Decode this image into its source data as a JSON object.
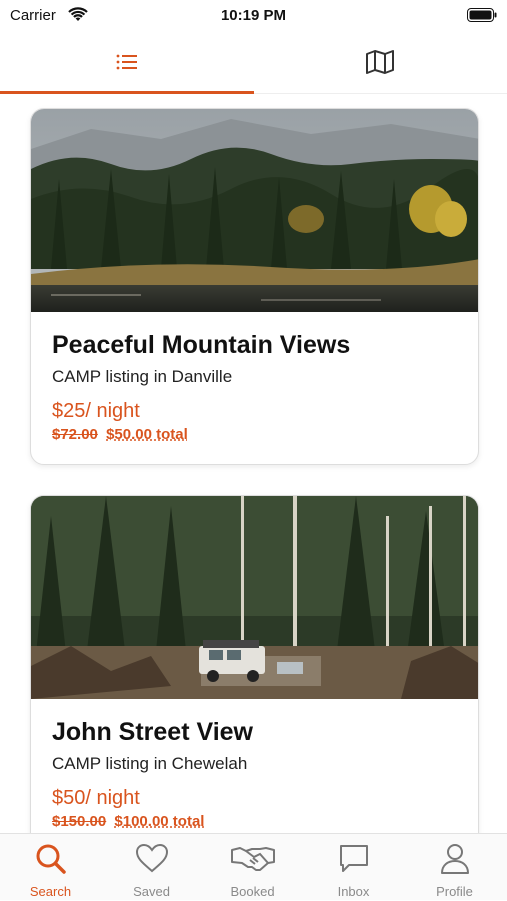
{
  "status_bar": {
    "carrier": "Carrier",
    "time": "10:19 PM"
  },
  "top_tabs": {
    "list_icon": "list-icon",
    "map_icon": "map-icon",
    "active": "list"
  },
  "listings": [
    {
      "title": "Peaceful Mountain Views",
      "subtitle": "CAMP listing in Danville",
      "price": "$25/ night",
      "original_total": "$72.00",
      "total": "$50.00 total",
      "photo": "lake-forest-photo"
    },
    {
      "title": "John Street View",
      "subtitle": "CAMP listing in Chewelah",
      "price": "$50/ night",
      "original_total": "$150.00",
      "total": "$100.00 total",
      "photo": "forest-truck-photo"
    }
  ],
  "bottom_nav": [
    {
      "label": "Search",
      "icon": "search-icon"
    },
    {
      "label": "Saved",
      "icon": "heart-icon"
    },
    {
      "label": "Booked",
      "icon": "handshake-icon"
    },
    {
      "label": "Inbox",
      "icon": "chat-icon"
    },
    {
      "label": "Profile",
      "icon": "person-icon"
    }
  ],
  "colors": {
    "accent": "#d9541e",
    "inactive": "#8a8a8a"
  }
}
